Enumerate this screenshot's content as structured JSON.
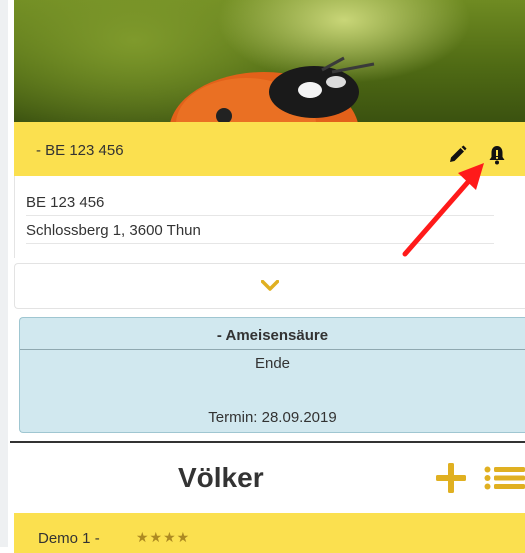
{
  "hive": {
    "title": "- BE 123 456",
    "number": "BE 123 456",
    "address": "Schlossberg 1, 3600 Thun"
  },
  "treatment": {
    "name": "- Ameisensäure",
    "status": "Ende",
    "date": "Termin: 28.09.2019"
  },
  "colonies": {
    "title": "Völker",
    "items": [
      {
        "name": "Demo 1 -",
        "stars": "★★★★"
      }
    ]
  },
  "icons": {
    "edit": "pencil-icon",
    "notify": "bell-icon",
    "expand": "chevron-down-icon",
    "add": "plus-icon",
    "list": "list-icon"
  },
  "colors": {
    "header_yellow": "#fbe04f",
    "accent_gold": "#e0b021",
    "treatment_bg": "#d1e8ef",
    "arrow_red": "#ff1a1a"
  }
}
